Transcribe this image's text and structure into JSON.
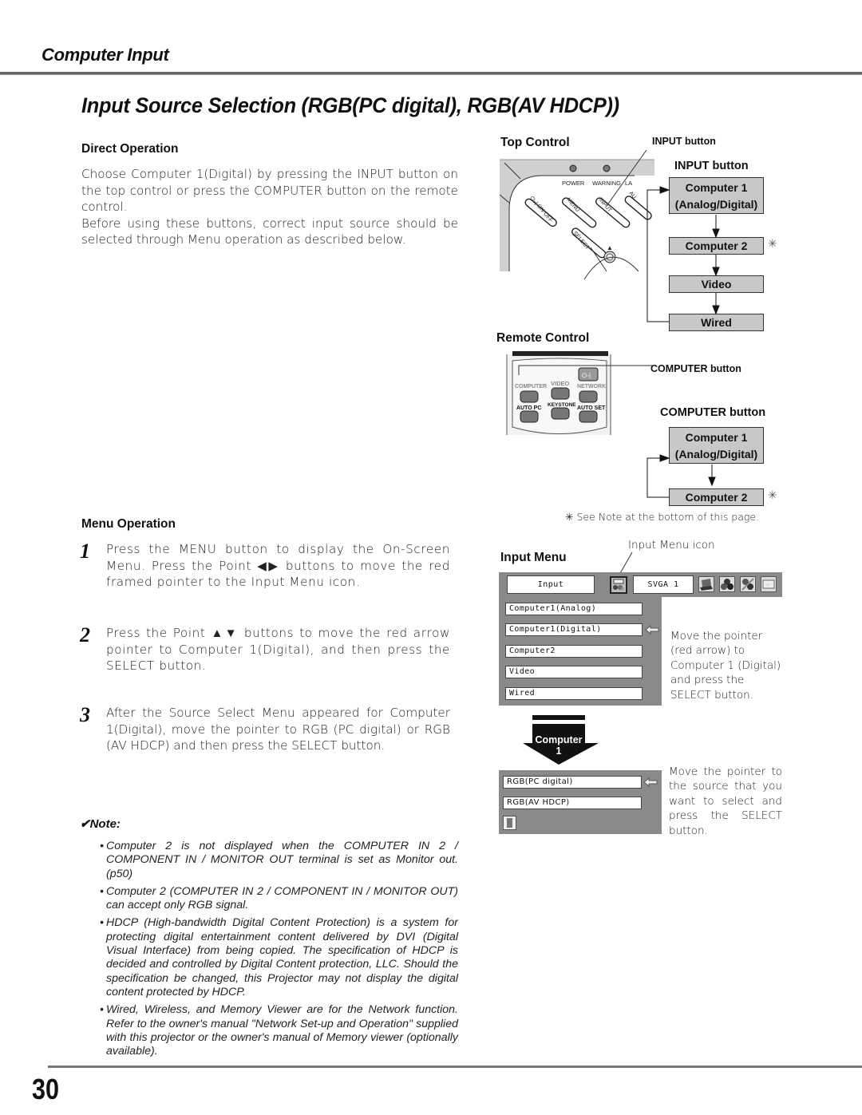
{
  "header": {
    "section_title": "Computer Input",
    "page_heading": "Input Source Selection (RGB(PC digital), RGB(AV HDCP))"
  },
  "direct_operation": {
    "heading": "Direct Operation",
    "paragraph1": "Choose Computer 1(Digital) by pressing the INPUT button on the top control or press the COMPUTER button on the remote control.",
    "paragraph2": "Before using these buttons, correct input source should be selected through Menu operation as described below."
  },
  "menu_operation": {
    "heading": "Menu Operation",
    "steps": [
      {
        "num": "1",
        "text": "Press the MENU button to display the On-Screen Menu.  Press the Point ◀▶ buttons to move the red framed pointer to the Input Menu icon."
      },
      {
        "num": "2",
        "text": "Press the Point ▲▼ buttons to move the red arrow pointer to Computer 1(Digital), and then press the SELECT button."
      },
      {
        "num": "3",
        "text": "After the Source Select Menu appeared for Computer 1(Digital),  move the pointer to RGB (PC digital) or RGB (AV HDCP) and then press the SELECT button."
      }
    ]
  },
  "note": {
    "label": "Note:",
    "check_icon": "✔",
    "items": [
      "Computer 2 is not displayed when the COMPUTER IN 2 / COMPONENT IN / MONITOR OUT terminal is set as Monitor out. (p50)",
      "Computer 2 (COMPUTER IN 2 / COMPONENT IN / MONITOR OUT) can accept only RGB signal.",
      "HDCP (High-bandwidth Digital Content Protection) is a system for protecting digital entertainment content delivered by DVI (Digital Visual Interface) from being copied.  The specification of HDCP is decided and controlled by Digital Content protection, LLC. Should the specification be changed, this Projector may not display the digital content protected by HDCP.",
      "Wired, Wireless, and Memory Viewer are for the Network function. Refer to the owner's manual \"Network Set-up and Operation\" supplied with this projector or the owner's manual of Memory viewer (optionally available)."
    ]
  },
  "top_control": {
    "heading": "Top Control",
    "callout": "INPUT button",
    "panel_labels": {
      "power": "POWER",
      "warning": "WARNING",
      "lamp": "LA",
      "on_off": "⏻–| ON·OFF",
      "menu": "MENU",
      "input": "INPUT",
      "auto": "AU",
      "select": "SELECT",
      "up": "▲"
    },
    "flow_title": "INPUT button",
    "flow": [
      {
        "line1": "Computer 1",
        "line2": "(Analog/Digital)"
      },
      {
        "line1": "Computer 2",
        "asterisk": "✳"
      },
      {
        "line1": "Video"
      },
      {
        "line1": "Wired"
      }
    ]
  },
  "remote_control": {
    "heading": "Remote Control",
    "callout": "COMPUTER button",
    "remote_labels": {
      "computer": "COMPUTER",
      "video": "VIDEO",
      "network": "NETWORK",
      "auto_pc": "AUTO PC",
      "keystone": "KEYSTONE",
      "auto_set": "AUTO SET",
      "power": "⏻-|"
    },
    "flow_title": "COMPUTER button",
    "flow": [
      {
        "line1": "Computer 1",
        "line2": "(Analog/Digital)"
      },
      {
        "line1": "Computer 2",
        "asterisk": "✳"
      }
    ],
    "footnote": "✳ See Note at the bottom of this page."
  },
  "input_menu": {
    "heading": "Input Menu",
    "icon_callout": "Input Menu icon",
    "bar": {
      "input_label": "Input",
      "signal_label": "SVGA 1"
    },
    "bar_icons": [
      "input-menu-icon",
      "laptop-icon",
      "color-balls-icon",
      "image-adjust-icon",
      "screen-icon"
    ],
    "items": [
      "Computer1(Analog)",
      "Computer1(Digital)",
      "Computer2",
      "Video",
      "Wired"
    ],
    "selected_index": 1,
    "caption": "Move the pointer (red arrow) to Computer 1 (Digital) and press the SELECT button.",
    "arrow_label_line1": "Computer",
    "arrow_label_line2": "1",
    "sub_items": [
      "RGB(PC digital)",
      "RGB(AV HDCP)"
    ],
    "sub_selected_index": 0,
    "sub_caption": "Move the pointer to the source that you want to select and press the SELECT button."
  },
  "footer": {
    "page_number": "30"
  }
}
